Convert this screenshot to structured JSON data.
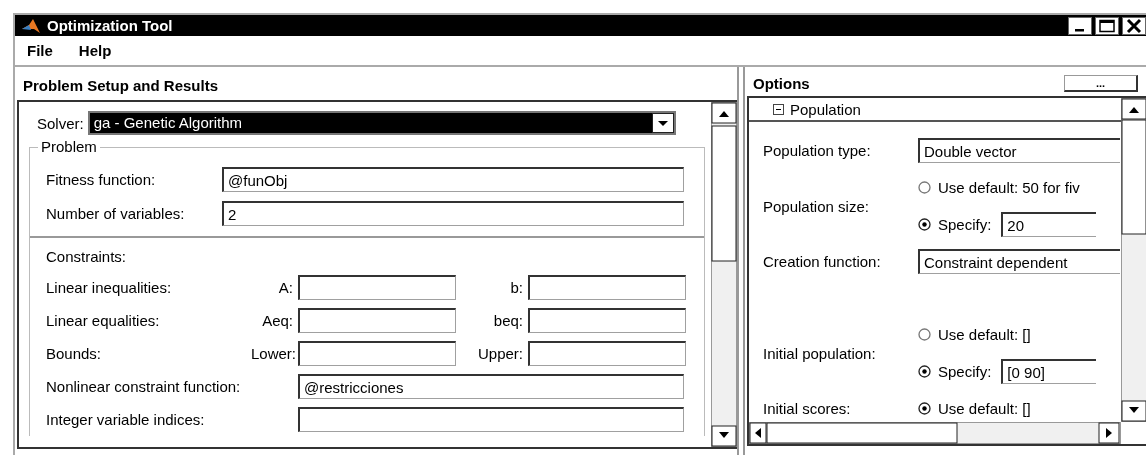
{
  "window": {
    "title": "Optimization Tool"
  },
  "menu": [
    {
      "label": "File"
    },
    {
      "label": "Help"
    }
  ],
  "problem_panel": {
    "title": "Problem Setup and Results",
    "solver": {
      "label": "Solver:",
      "value": "ga - Genetic Algorithm"
    },
    "problem": {
      "title": "Problem",
      "fields": [
        {
          "label": "Fitness function:",
          "value": "@funObj"
        },
        {
          "label": "Number of variables:",
          "value": "2"
        }
      ]
    },
    "constraints": {
      "title": "Constraints:",
      "rows": [
        {
          "kind": "pair",
          "label": "Linear inequalities:",
          "fields": [
            {
              "label": "A:"
            },
            {
              "label": "b:"
            }
          ]
        },
        {
          "kind": "pair",
          "label": "Linear equalities:",
          "fields": [
            {
              "label": "Aeq:"
            },
            {
              "label": "beq:"
            }
          ]
        },
        {
          "kind": "pair",
          "label": "Bounds:",
          "fields": [
            {
              "label": "Lower:"
            },
            {
              "label": "Upper:"
            }
          ]
        },
        {
          "kind": "single",
          "label": "Nonlinear constraint function:",
          "value": "@restricciones"
        },
        {
          "kind": "single",
          "label": "Integer variable indices:"
        }
      ]
    }
  },
  "options_panel": {
    "title": "Options",
    "button": "...",
    "section": {
      "title": "Population",
      "expanded": true,
      "rows": [
        {
          "kind": "field",
          "label": "Population type:",
          "value": "Double vector"
        },
        {
          "kind": "radio",
          "label": "Population size:",
          "options": [
            {
              "label": "Use default: 50 for fiv",
              "selected": false
            },
            {
              "label": "Specify:",
              "selected": true,
              "value": "20"
            }
          ]
        },
        {
          "kind": "field",
          "label": "Creation function:",
          "value": "Constraint dependent"
        },
        {
          "kind": "radio",
          "label": "Initial population:",
          "options": [
            {
              "label": "Use default: []",
              "selected": false
            },
            {
              "label": "Specify:",
              "selected": true,
              "value": "[0 90]"
            }
          ]
        },
        {
          "kind": "radio",
          "label": "Initial scores:",
          "options": [
            {
              "label": "Use default: []",
              "selected": true
            }
          ]
        }
      ]
    }
  }
}
